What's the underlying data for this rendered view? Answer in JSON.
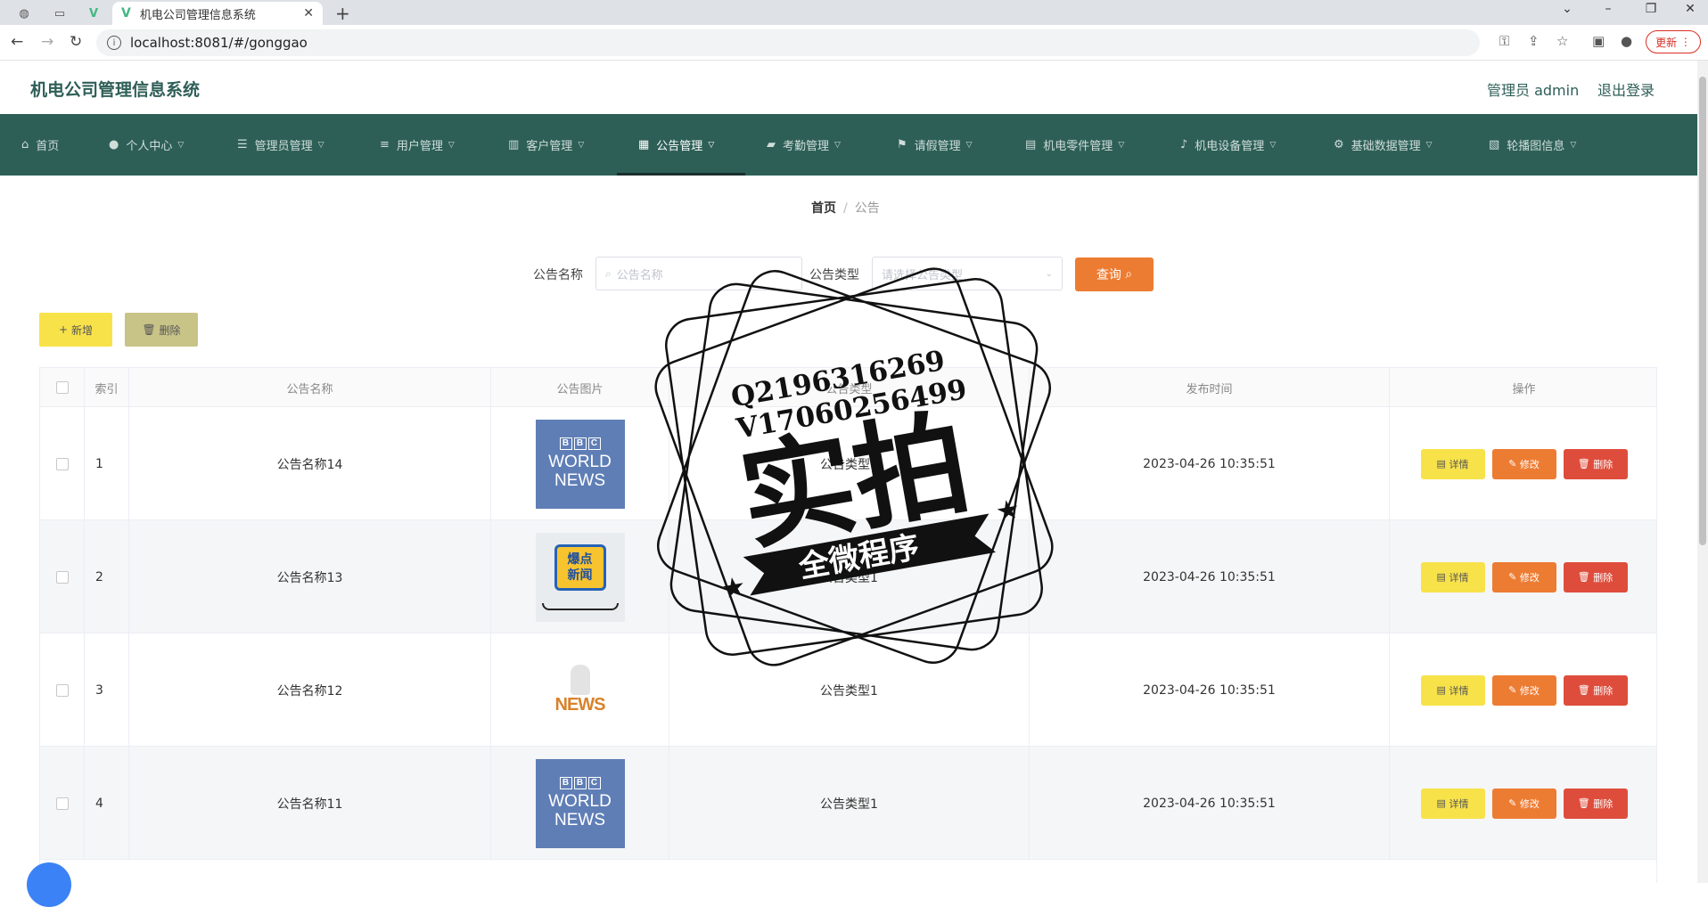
{
  "browser": {
    "tab_title": "机电公司管理信息系统",
    "url": "localhost:8081/#/gonggao",
    "update_label": "更新"
  },
  "header": {
    "app_title": "机电公司管理信息系统",
    "admin_label": "管理员 admin",
    "logout_label": "退出登录"
  },
  "nav": {
    "items": [
      {
        "label": "首页",
        "icon": "home-icon"
      },
      {
        "label": "个人中心",
        "icon": "user-icon"
      },
      {
        "label": "管理员管理",
        "icon": "sliders-icon"
      },
      {
        "label": "用户管理",
        "icon": "list-icon"
      },
      {
        "label": "客户管理",
        "icon": "bar-chart-icon"
      },
      {
        "label": "公告管理",
        "icon": "grid-icon"
      },
      {
        "label": "考勤管理",
        "icon": "briefcase-icon"
      },
      {
        "label": "请假管理",
        "icon": "flag-icon"
      },
      {
        "label": "机电零件管理",
        "icon": "building-icon"
      },
      {
        "label": "机电设备管理",
        "icon": "microphone-icon"
      },
      {
        "label": "基础数据管理",
        "icon": "settings-icon"
      },
      {
        "label": "轮播图信息",
        "icon": "image-icon"
      }
    ],
    "active_index": 5
  },
  "breadcrumb": {
    "home": "首页",
    "current": "公告"
  },
  "search": {
    "name_label": "公告名称",
    "name_placeholder": "公告名称",
    "type_label": "公告类型",
    "type_placeholder": "请选择公告类型",
    "query_label": "查询"
  },
  "actions": {
    "add_label": "新增",
    "delete_label": "删除"
  },
  "table": {
    "columns": [
      "索引",
      "公告名称",
      "公告图片",
      "公告类型",
      "发布时间",
      "操作"
    ],
    "rows": [
      {
        "index": "1",
        "name": "公告名称14",
        "image": "bbc",
        "type": "公告类型1",
        "time": "2023-04-26 10:35:51"
      },
      {
        "index": "2",
        "name": "公告名称13",
        "image": "hot",
        "type": "公告类型1",
        "time": "2023-04-26 10:35:51"
      },
      {
        "index": "3",
        "name": "公告名称12",
        "image": "news3d",
        "type": "公告类型1",
        "time": "2023-04-26 10:35:51"
      },
      {
        "index": "4",
        "name": "公告名称11",
        "image": "bbc",
        "type": "公告类型1",
        "time": "2023-04-26 10:35:51"
      }
    ],
    "op_labels": {
      "detail": "详情",
      "edit": "修改",
      "remove": "删除"
    }
  },
  "image_texts": {
    "bbc_logo": [
      "B",
      "B",
      "C"
    ],
    "bbc_line1": "WORLD",
    "bbc_line2": "NEWS",
    "hot_line1": "爆点",
    "hot_line2": "新闻",
    "news3d_word": "NEWS"
  },
  "watermark": {
    "line1": "Q2196316269",
    "line2": "V17060256499",
    "main": "实拍",
    "ribbon": "全微程序"
  }
}
